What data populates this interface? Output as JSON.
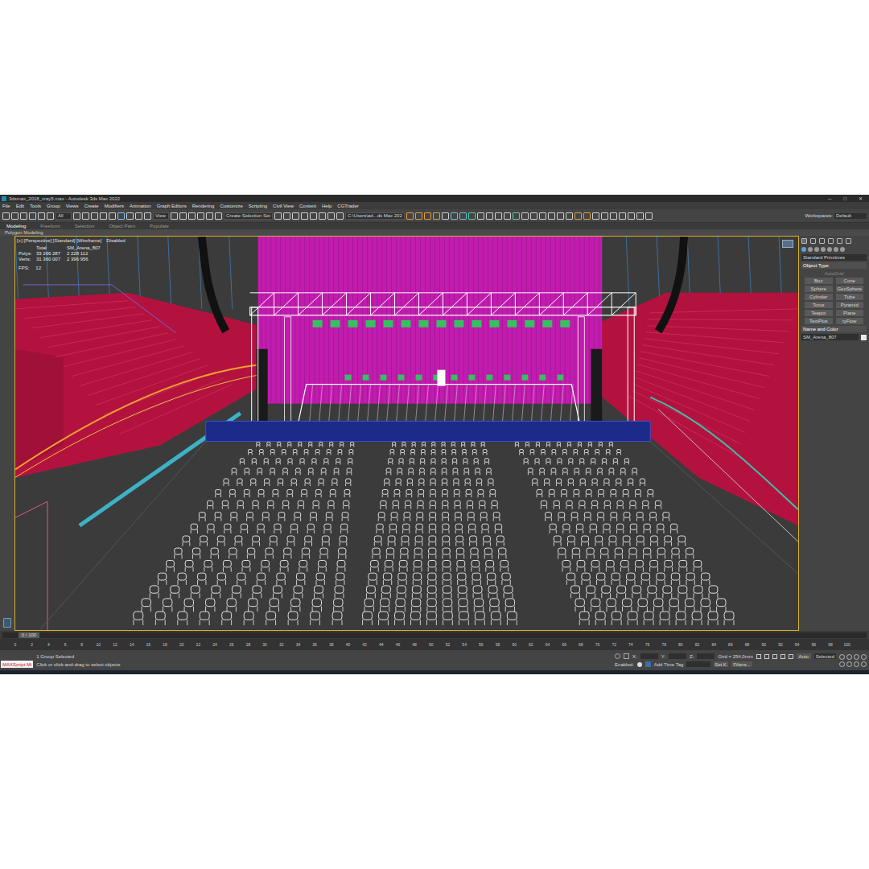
{
  "window": {
    "title": "3dsmax_2018_vray5.max - Autodesk 3ds Max 2022",
    "controls": [
      "─",
      "□",
      "✕"
    ]
  },
  "menu": [
    "File",
    "Edit",
    "Tools",
    "Group",
    "Views",
    "Create",
    "Modifiers",
    "Animation",
    "Graph Editors",
    "Rendering",
    "Customize",
    "Scripting",
    "Civil View",
    "Content",
    "Help",
    "CGTrader"
  ],
  "workspace": {
    "label": "Workspaces:",
    "value": "Default"
  },
  "toolbar": {
    "filter": "All",
    "view": "View",
    "selection_set": "Create Selection Set",
    "path": "C:\\Users\\ad...ds Max 202"
  },
  "ribbon": {
    "tabs": [
      {
        "label": "Modeling",
        "selected": true
      },
      {
        "label": "Freeform",
        "selected": false
      },
      {
        "label": "Selection",
        "selected": false
      },
      {
        "label": "Object Paint",
        "selected": false
      },
      {
        "label": "Populate",
        "selected": false
      }
    ],
    "panel": "Polygon Modeling"
  },
  "viewport": {
    "label": "[+] [Perspective] [Standard] [Wireframe]",
    "overlay": "Disabled",
    "stats_header": {
      "label": "Total",
      "object": "SM_Arena_807"
    },
    "stats": [
      {
        "label": "Polys:",
        "total": "33 266 287",
        "selected": "2 228 112"
      },
      {
        "label": "Verts:",
        "total": "31 360 007",
        "selected": "2 396 956"
      }
    ],
    "fps": {
      "label": "FPS:",
      "value": "12"
    }
  },
  "command_panel": {
    "category": "Standard Primitives",
    "object_type": "Object Type",
    "autogrid": "AutoGrid",
    "buttons": [
      "Box",
      "Cone",
      "Sphere",
      "GeoSphere",
      "Cylinder",
      "Tube",
      "Torus",
      "Pyramid",
      "Teapot",
      "Plane",
      "TextPlus",
      "tyFlow"
    ],
    "name_color": "Name and Color",
    "object_name": "SM_Arena_807"
  },
  "timeline": {
    "frame": "0 / 100",
    "ticks": [
      "0",
      "2",
      "4",
      "6",
      "8",
      "10",
      "12",
      "14",
      "16",
      "18",
      "20",
      "22",
      "24",
      "26",
      "28",
      "30",
      "32",
      "34",
      "36",
      "38",
      "40",
      "42",
      "44",
      "46",
      "48",
      "50",
      "52",
      "54",
      "56",
      "58",
      "60",
      "62",
      "64",
      "66",
      "68",
      "70",
      "72",
      "74",
      "76",
      "78",
      "80",
      "82",
      "84",
      "86",
      "88",
      "90",
      "92",
      "94",
      "96",
      "98",
      "100"
    ]
  },
  "status": {
    "script": "MAXScript Mi",
    "selection": "1 Group Selected",
    "prompt": "Click or click-and-drag to select objects",
    "coords": [
      "X:",
      "Y:",
      "Z:"
    ],
    "grid": "Grid = 254,0mm",
    "enabled": "Enabled:",
    "time_tag": "Add Time Tag",
    "key_mode": "Auto",
    "key_filter": "Selected",
    "set_key": "Set K.",
    "filters": "Filters..."
  }
}
